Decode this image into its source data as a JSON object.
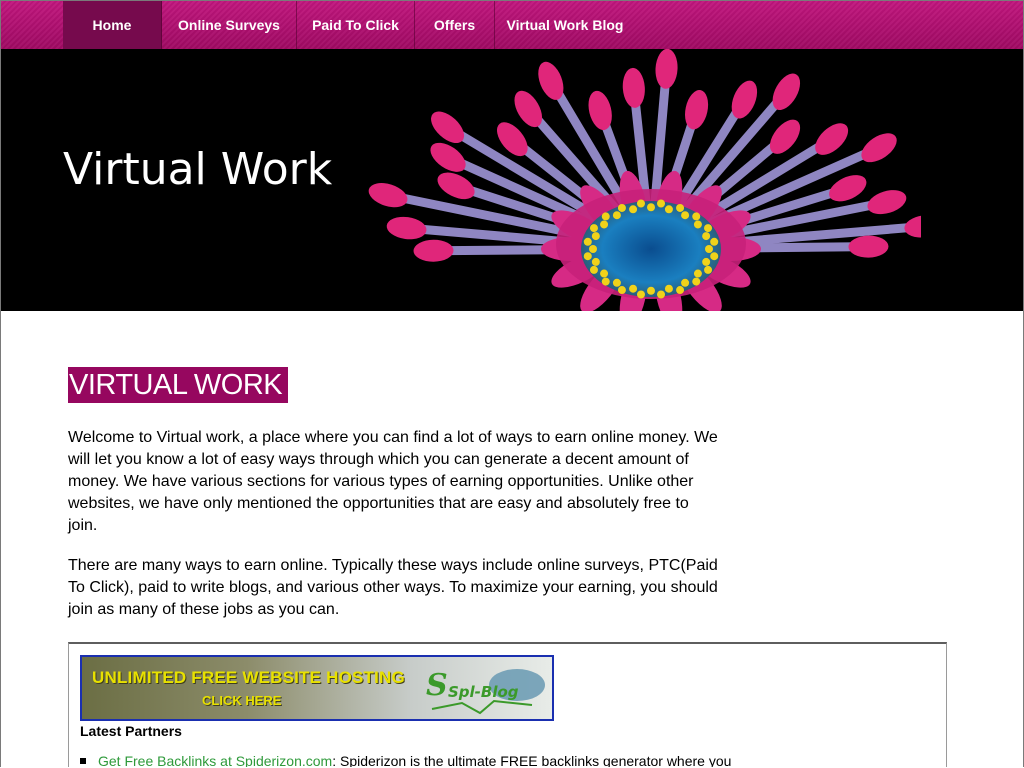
{
  "nav": {
    "items": [
      {
        "label": "Home",
        "active": true
      },
      {
        "label": "Online Surveys",
        "active": false
      },
      {
        "label": "Paid To Click",
        "active": false
      },
      {
        "label": "Offers",
        "active": false
      },
      {
        "label": "Virtual Work Blog",
        "active": false
      }
    ]
  },
  "banner": {
    "title": "Virtual Work"
  },
  "main": {
    "heading": "VIRTUAL WORK",
    "paragraphs": [
      "Welcome to Virtual work, a place where you can find a lot of ways to earn online money. We will let you know a lot of easy ways through which you can generate a decent amount of money. We have various sections for various types of earning opportunities. Unlike other websites, we have only mentioned the opportunities that are easy and absolutely free to join.",
      "There are many ways to earn online. Typically these ways include online surveys, PTC(Paid To Click), paid to write blogs, and various other ways. To maximize your earning, you should join as many of these jobs as you can."
    ]
  },
  "partners": {
    "ad": {
      "line1": "UNLIMITED FREE WEBSITE HOSTING",
      "line2": "CLICK HERE",
      "logo_text": "Spl-Blog"
    },
    "label": "Latest Partners",
    "items": [
      {
        "link_text": "Get Free Backlinks at Spiderizon.com",
        "text": ": Spiderizon is the ultimate FREE backlinks generator where you"
      }
    ]
  },
  "colors": {
    "nav_bg": "#b10f70",
    "nav_active": "#760a4d",
    "heading_bg": "#96075f",
    "link": "#2e9a3a"
  }
}
